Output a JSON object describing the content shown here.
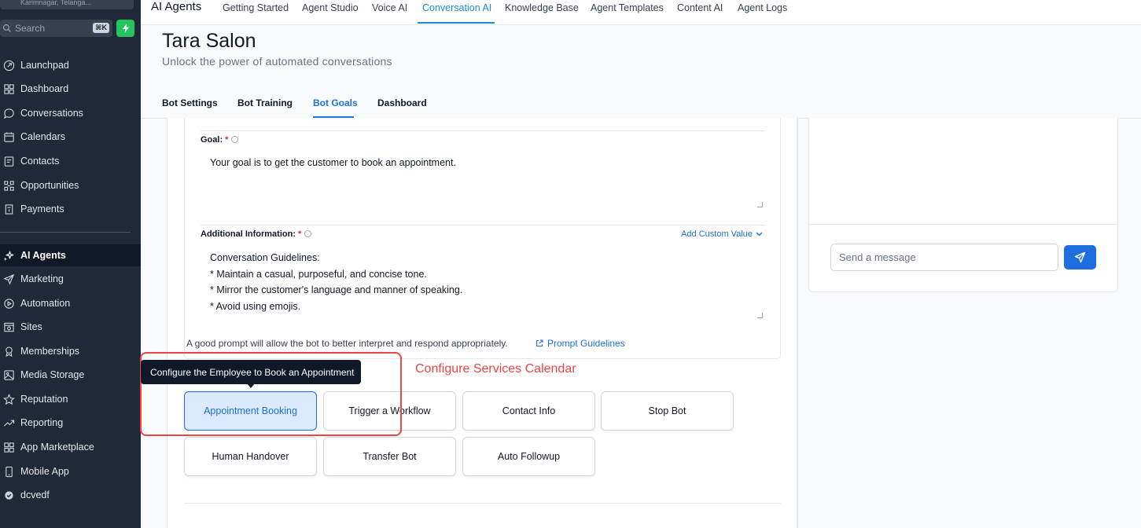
{
  "sidebar": {
    "location": "Karimnagar, Telanga...",
    "search_placeholder": "Search",
    "search_shortcut": "⌘K",
    "items": [
      {
        "label": "Launchpad",
        "icon": "rocket-icon"
      },
      {
        "label": "Dashboard",
        "icon": "grid-icon"
      },
      {
        "label": "Conversations",
        "icon": "chat-icon"
      },
      {
        "label": "Calendars",
        "icon": "calendar-icon"
      },
      {
        "label": "Contacts",
        "icon": "contacts-icon"
      },
      {
        "label": "Opportunities",
        "icon": "opportunities-icon"
      },
      {
        "label": "Payments",
        "icon": "receipt-icon"
      },
      {
        "label": "AI Agents",
        "icon": "sparkle-icon"
      },
      {
        "label": "Marketing",
        "icon": "send-icon"
      },
      {
        "label": "Automation",
        "icon": "automation-icon"
      },
      {
        "label": "Sites",
        "icon": "sites-icon"
      },
      {
        "label": "Memberships",
        "icon": "award-icon"
      },
      {
        "label": "Media Storage",
        "icon": "image-icon"
      },
      {
        "label": "Reputation",
        "icon": "star-icon"
      },
      {
        "label": "Reporting",
        "icon": "trend-icon"
      },
      {
        "label": "App Marketplace",
        "icon": "apps-icon"
      },
      {
        "label": "Mobile App",
        "icon": "mobile-icon"
      },
      {
        "label": "dcvedf",
        "icon": "badge-icon"
      }
    ],
    "active": "AI Agents"
  },
  "topnav": {
    "brand": "AI Agents",
    "tabs": [
      "Getting Started",
      "Agent Studio",
      "Voice AI",
      "Conversation AI",
      "Knowledge Base",
      "Agent Templates",
      "Content AI",
      "Agent Logs"
    ],
    "active": "Conversation AI"
  },
  "page": {
    "title": "Tara Salon",
    "subtitle": "Unlock the power of automated conversations",
    "tabs": [
      "Bot Settings",
      "Bot Training",
      "Bot Goals",
      "Dashboard"
    ],
    "active_tab": "Bot Goals"
  },
  "form": {
    "goal_label": "Goal:",
    "goal_required": "*",
    "goal_value": "Your goal is to get the customer to book an appointment.",
    "additional_label": "Additional Information:",
    "additional_required": "*",
    "add_custom_value": "Add Custom Value",
    "additional_lines": [
      "Conversation Guidelines:",
      "* Maintain a casual, purposeful, and concise tone.",
      "* Mirror the customer's language and manner of speaking.",
      "* Avoid using emojis."
    ],
    "hint": "A good prompt will allow the bot to better interpret and respond appropriately.",
    "prompt_link": "Prompt Guidelines"
  },
  "tooltip": "Configure the Employee to Book an Appointment",
  "annotation": "Configure Services Calendar",
  "goal_buttons": [
    {
      "label": "Appointment Booking",
      "selected": true
    },
    {
      "label": "Trigger a Workflow",
      "selected": false
    },
    {
      "label": "Contact Info",
      "selected": false
    },
    {
      "label": "Stop Bot",
      "selected": false
    },
    {
      "label": "Human Handover",
      "selected": false
    },
    {
      "label": "Transfer Bot",
      "selected": false
    },
    {
      "label": "Auto Followup",
      "selected": false
    }
  ],
  "chat": {
    "message_placeholder": "Send a message"
  },
  "colors": {
    "accent": "#1f6ee0",
    "tab_accent": "#1d8bd6",
    "sidebar_bg": "#1f2937",
    "annotation": "#ef4444",
    "bolt": "#22c55e"
  }
}
